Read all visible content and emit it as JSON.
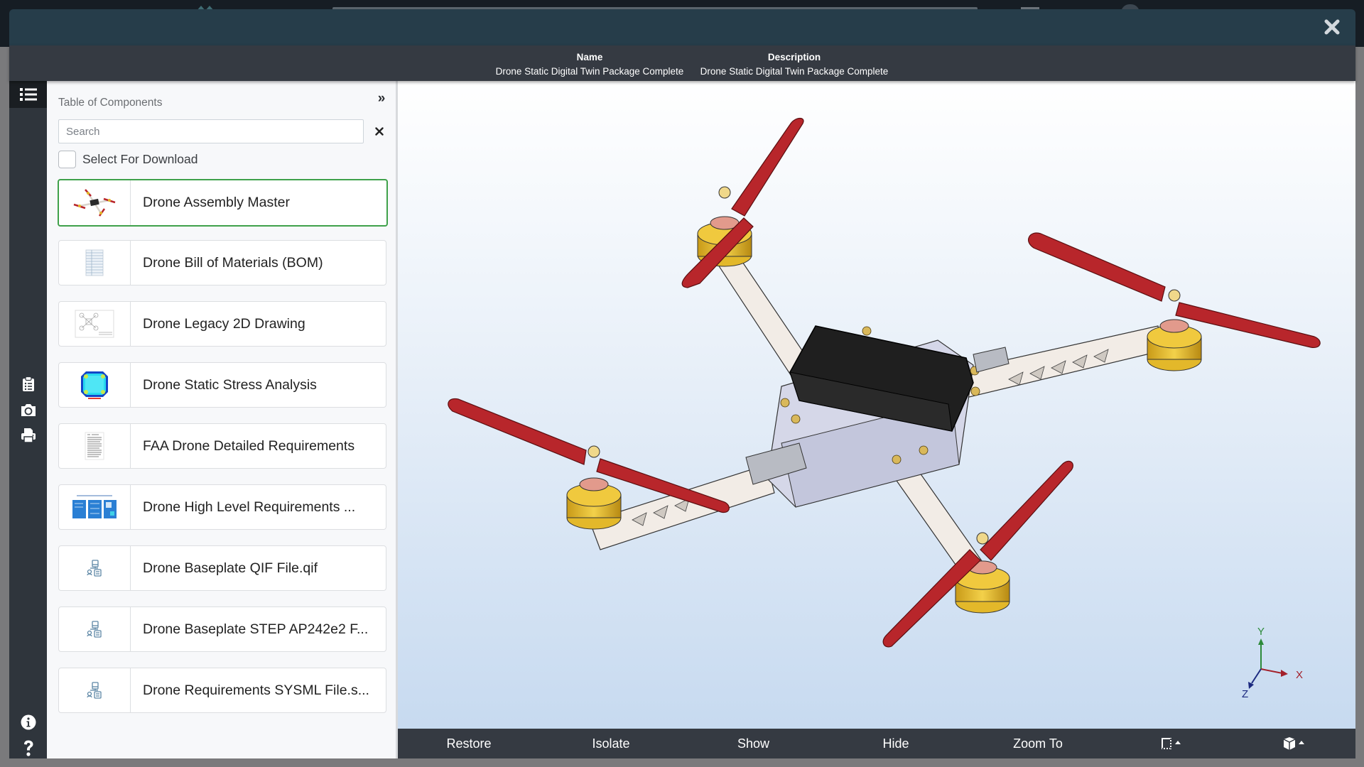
{
  "modal": {
    "close_icon": "close-icon",
    "info": {
      "name_label": "Name",
      "name_value": "Drone Static Digital Twin Package Complete",
      "description_label": "Description",
      "description_value": "Drone Static Digital Twin Package Complete"
    }
  },
  "rail": {
    "top": [
      {
        "icon": "list-icon",
        "name": "table-of-components"
      }
    ],
    "middle": [
      {
        "icon": "clipboard-list-icon",
        "name": "notes"
      },
      {
        "icon": "camera-icon",
        "name": "snapshot"
      },
      {
        "icon": "print-icon",
        "name": "print"
      }
    ],
    "bottom": [
      {
        "icon": "info-icon",
        "name": "info"
      },
      {
        "icon": "help-icon",
        "name": "help"
      }
    ]
  },
  "panel": {
    "title": "Table of Components",
    "collapse_label": "»",
    "search": {
      "placeholder": "Search",
      "value": ""
    },
    "select_download_label": "Select For Download",
    "select_download_checked": false,
    "items": [
      {
        "label": "Drone Assembly Master",
        "thumb": "drone-thumbnail",
        "active": true
      },
      {
        "label": "Drone Bill of Materials (BOM)",
        "thumb": "spreadsheet-thumbnail",
        "active": false
      },
      {
        "label": "Drone Legacy 2D Drawing",
        "thumb": "drawing-thumbnail",
        "active": false
      },
      {
        "label": "Drone Static Stress Analysis",
        "thumb": "stress-plot-thumbnail",
        "active": false
      },
      {
        "label": "FAA Drone Detailed Requirements",
        "thumb": "document-thumbnail",
        "active": false
      },
      {
        "label": "Drone High Level Requirements ...",
        "thumb": "diagram-thumbnail",
        "active": false
      },
      {
        "label": "Drone Baseplate QIF File.qif",
        "thumb": "generic-file-icon",
        "active": false
      },
      {
        "label": "Drone Baseplate STEP AP242e2 F...",
        "thumb": "generic-file-icon",
        "active": false
      },
      {
        "label": "Drone Requirements SYSML File.s...",
        "thumb": "generic-file-icon",
        "active": false
      }
    ]
  },
  "viewer": {
    "axes": {
      "x": "X",
      "y": "Y",
      "z": "Z"
    },
    "colors": {
      "x_axis": "#a3202a",
      "y_axis": "#2d8a3a",
      "z_axis": "#1c2a80",
      "propeller": "#b8262b",
      "motor": "#e3b82a",
      "frame": "#f2ece6",
      "body": "#1f1f1f",
      "plate": "#d5d7e8"
    }
  },
  "toolbar": {
    "buttons": [
      {
        "label": "Restore",
        "name": "restore-button"
      },
      {
        "label": "Isolate",
        "name": "isolate-button"
      },
      {
        "label": "Show",
        "name": "show-button"
      },
      {
        "label": "Hide",
        "name": "hide-button"
      },
      {
        "label": "Zoom To",
        "name": "zoom-to-button"
      }
    ],
    "icon_buttons": [
      {
        "icon": "section-view-icon",
        "name": "section-view-dropdown"
      },
      {
        "icon": "view-cube-icon",
        "name": "view-orientation-dropdown"
      }
    ]
  }
}
